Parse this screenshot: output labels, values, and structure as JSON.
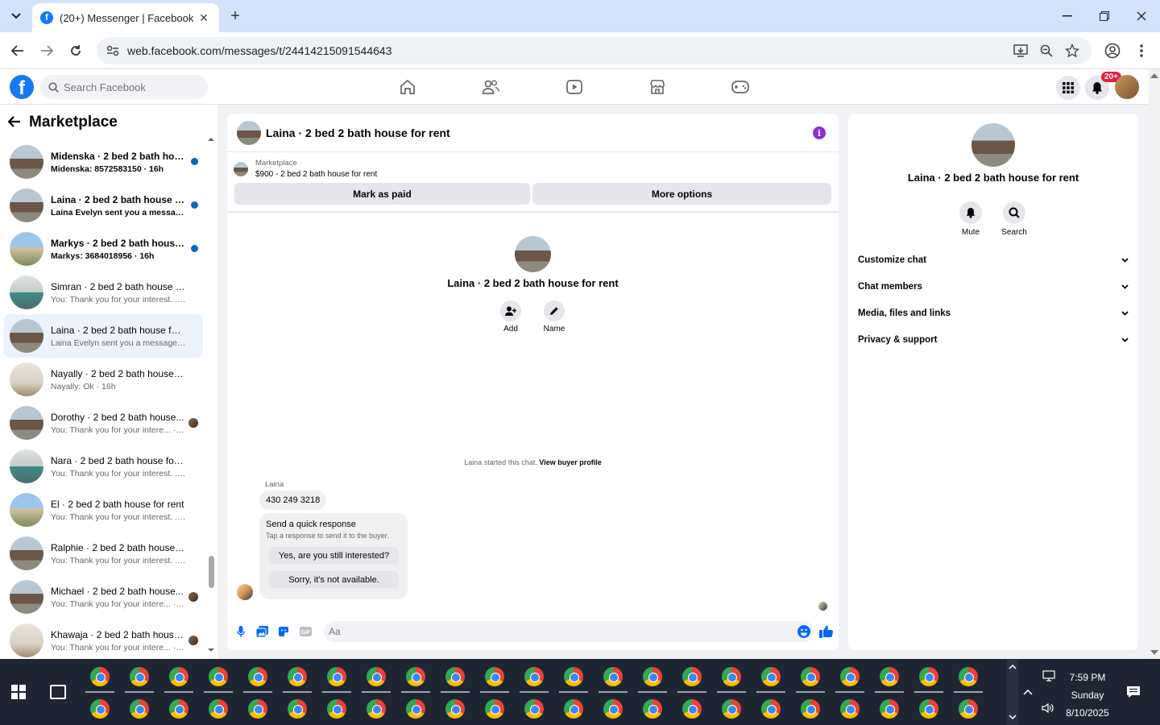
{
  "browser": {
    "tab_title": "(20+) Messenger | Facebook",
    "url": "web.facebook.com/messages/t/24414215091544643"
  },
  "fb": {
    "search_placeholder": "Search Facebook",
    "notification_count": "20+"
  },
  "left_panel": {
    "title": "Marketplace",
    "conversations": [
      {
        "name": "Midenska · 2 bed 2 bath hous...",
        "preview": "Midenska: 8572583150 · 16h",
        "unread": true,
        "thumb": "house"
      },
      {
        "name": "Laina · 2 bed 2 bath house for...",
        "preview": "Laina Evelyn sent you a messa... · 16h",
        "unread": true,
        "thumb": "house"
      },
      {
        "name": "Markys · 2 bed 2 bath house f...",
        "preview": "Markys: 3684018956 · 16h",
        "unread": true,
        "thumb": "blue"
      },
      {
        "name": "Simran · 2 bed 2 bath house for...",
        "preview": "You: Thank you for your interest. ... · 16h",
        "unread": false,
        "thumb": "teal"
      },
      {
        "name": "Laina · 2 bed 2 bath house for r...",
        "preview": "Laina Evelyn sent you a message ... · 16h",
        "unread": false,
        "thumb": "house",
        "active": true
      },
      {
        "name": "Nayally · 2 bed 2 bath house fo...",
        "preview": "Nayally: Ok · 16h",
        "unread": false,
        "thumb": "interior"
      },
      {
        "name": "Dorothy · 2 bed 2 bath house...",
        "preview": "You: Thank you for your intere... · 16h",
        "unread": false,
        "thumb": "house",
        "seen": true
      },
      {
        "name": "Nara · 2 bed 2 bath house for r...",
        "preview": "You: Thank you for your interest. ... · 16h",
        "unread": false,
        "thumb": "teal"
      },
      {
        "name": "El · 2 bed 2 bath house for rent",
        "preview": "You: Thank you for your interest. ... · 16h",
        "unread": false,
        "thumb": "blue"
      },
      {
        "name": "Ralphie · 2 bed 2 bath house fo...",
        "preview": "You: Thank you for your interest. ... · 16h",
        "unread": false,
        "thumb": "house"
      },
      {
        "name": "Michael · 2 bed 2 bath house...",
        "preview": "You: Thank you for your intere... · 16h",
        "unread": false,
        "thumb": "house",
        "seen": true
      },
      {
        "name": "Khawaja · 2 bed 2 bath house...",
        "preview": "You: Thank you for your intere... · 16h",
        "unread": false,
        "thumb": "interior",
        "seen": true
      }
    ]
  },
  "chat": {
    "title": "Laina · 2 bed 2 bath house for rent",
    "marketplace_label": "Marketplace",
    "listing": "$900 - 2 bed 2 bath house for rent",
    "mark_paid": "Mark as paid",
    "more_options": "More options",
    "intro_name": "Laina · 2 bed 2 bath house for rent",
    "add_label": "Add",
    "name_label": "Name",
    "started_text": "Laina started this chat.",
    "view_buyer": "View buyer profile",
    "sender": "Laina",
    "phone_message": "430 249 3218",
    "quick_title": "Send a quick response",
    "quick_sub": "Tap a response to send it to the buyer.",
    "quick_1": "Yes, are you still interested?",
    "quick_2": "Sorry, it's not available.",
    "composer_placeholder": "Aa"
  },
  "right_panel": {
    "name": "Laina · 2 bed 2 bath house for rent",
    "mute": "Mute",
    "search": "Search",
    "sections": [
      "Customize chat",
      "Chat members",
      "Media, files and links",
      "Privacy & support"
    ]
  },
  "taskbar": {
    "time": "7:59 PM",
    "day": "Sunday",
    "date": "8/10/2025"
  },
  "colors": {
    "accent": "#0866ff",
    "unread_dot": "#0a66c2",
    "info": "#8b2fd6"
  }
}
